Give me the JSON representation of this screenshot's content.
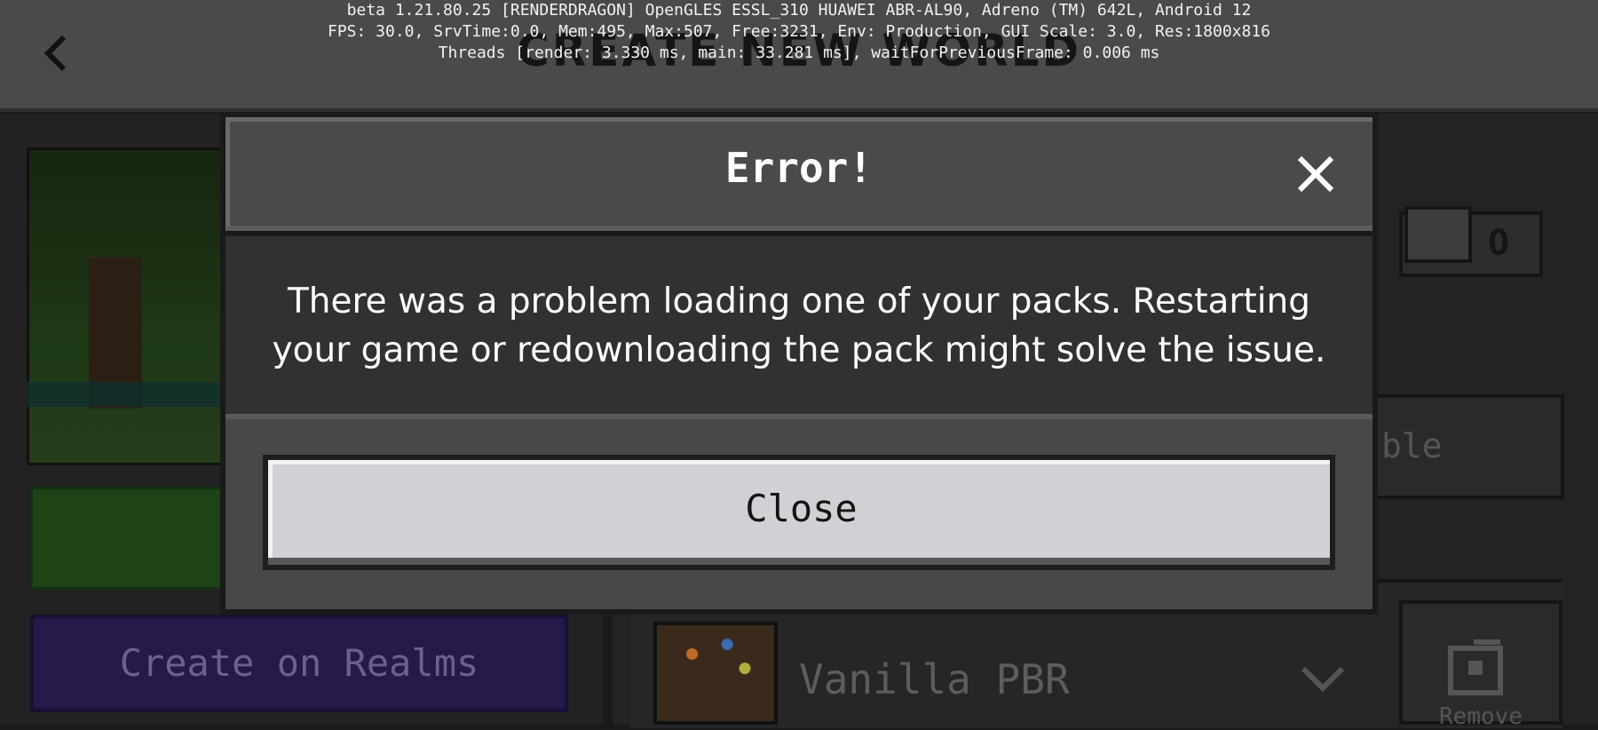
{
  "debug": {
    "line1": "beta 1.21.80.25 [RENDERDRAGON] OpenGLES ESSL_310 HUAWEI ABR-AL90, Adreno (TM) 642L, Android 12",
    "line2": "FPS: 30.0, SrvTime:0.0, Mem:495, Max:507, Free:3231, Env: Production, GUI Scale: 3.0, Res:1800x816",
    "line3": "Threads [render: 3.330 ms, main: 33.281 ms], waitForPreviousFrame: 0.006 ms"
  },
  "background": {
    "title": "CREATE NEW WORLD",
    "realms_button": "Create on Realms",
    "enable_label": "ble",
    "pack_name": "Vanilla PBR",
    "remove_label": "Remove"
  },
  "dialog": {
    "title": "Error!",
    "message": "There was a problem loading one of your packs. Restarting your game or redownloading the pack might solve the issue.",
    "close_button": "Close"
  },
  "icons": {
    "back": "back-arrow-icon",
    "close": "close-x-icon",
    "chevron": "chevron-down-icon",
    "trash": "trash-icon"
  },
  "colors": {
    "dialog_header": "#4a4a4c",
    "dialog_body": "#313133",
    "button_face": "#d0d1d4",
    "realms_purple": "#27194a"
  }
}
